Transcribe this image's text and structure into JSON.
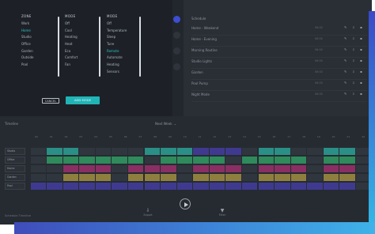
{
  "picker": {
    "columns": [
      {
        "header": "ZONE",
        "options": [
          "Work",
          "Home",
          "Studio",
          "Office",
          "Garden",
          "Outside",
          "Pool"
        ],
        "selected": 1
      },
      {
        "header": "MODE",
        "options": [
          "Off",
          "Cool",
          "Heating",
          "Heat",
          "Eco",
          "Comfort",
          "Fan"
        ],
        "selected": -1
      },
      {
        "header": "MODE",
        "options": [
          "Off",
          "Temperature",
          "Sleep",
          "Tune",
          "Remote",
          "Automate",
          "Heating",
          "Sensors"
        ],
        "selected": 4
      }
    ],
    "cancel_label": "CANCEL",
    "add_label": "ADD MODE"
  },
  "schedule_list": {
    "heading": "Schedule",
    "rows": [
      {
        "name": "Home - Weekend",
        "meta": "06:00"
      },
      {
        "name": "Home - Evening",
        "meta": "06:00"
      },
      {
        "name": "Morning Routine",
        "meta": "06:00"
      },
      {
        "name": "Studio Lights",
        "meta": "06:00"
      },
      {
        "name": "Garden",
        "meta": "06:00"
      },
      {
        "name": "Pool Pump",
        "meta": "06:00"
      },
      {
        "name": "Night Mode",
        "meta": "06:00"
      }
    ]
  },
  "timeline": {
    "title": "Timeline",
    "zoom_label": "Next Week",
    "hours": [
      "00",
      "01",
      "02",
      "03",
      "04",
      "05",
      "06",
      "07",
      "08",
      "09",
      "10",
      "11",
      "12",
      "13",
      "14",
      "15",
      "16",
      "17",
      "18",
      "19",
      "20",
      "21",
      "22"
    ],
    "lanes": [
      "Studio",
      "Office",
      "Home",
      "Garden",
      "Pool"
    ],
    "footer": "Schedule Timeline",
    "controls": {
      "download": "Export",
      "filter": "Filter"
    }
  },
  "colors": {
    "teal": "#2a8f86",
    "green": "#2f8a5c",
    "magenta": "#8a2f63",
    "olive": "#8f7f3f",
    "purple": "#3f3a8f",
    "accent": "#21b4b6"
  }
}
